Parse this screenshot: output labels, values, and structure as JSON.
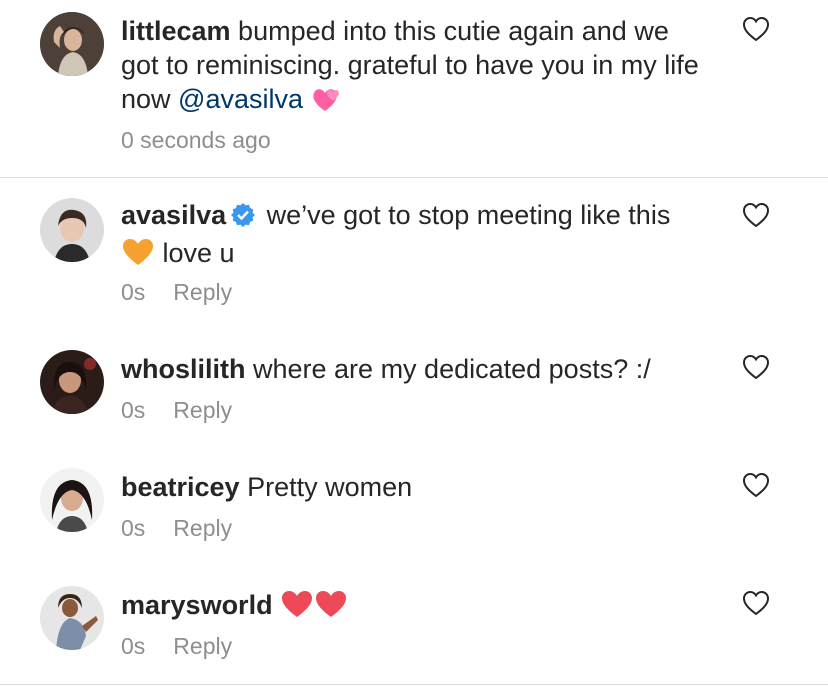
{
  "caption": {
    "username": "littlecam",
    "text_before_mention": " bumped into this cutie again and we got to reminiscing. grateful to have you in my life now ",
    "mention": "@avasilva",
    "emoji_icon": "two-hearts-emoji",
    "time": "0 seconds ago"
  },
  "comments": [
    {
      "username": "avasilva",
      "verified": true,
      "text_before_emoji": " we’ve got to stop meeting like this ",
      "emoji_icon": "orange-heart-emoji",
      "text_after_emoji": " love u",
      "time": "0s",
      "reply_label": "Reply"
    },
    {
      "username": "whoslilith",
      "text": " where are my dedicated posts? :/",
      "time": "0s",
      "reply_label": "Reply"
    },
    {
      "username": "beatricey",
      "text": " Pretty women",
      "time": "0s",
      "reply_label": "Reply"
    },
    {
      "username": "marysworld",
      "emoji_icons": [
        "red-heart-emoji",
        "red-heart-emoji"
      ],
      "time": "0s",
      "reply_label": "Reply"
    }
  ],
  "colors": {
    "text": "#262626",
    "secondary_text": "#8e8e8e",
    "mention": "#00376b",
    "divider": "#dbdbdb",
    "verified_badge": "#3897f0",
    "red_heart": "#ed4956",
    "orange_heart": "#f5a230",
    "pink_heart": "#ff5fa2"
  }
}
